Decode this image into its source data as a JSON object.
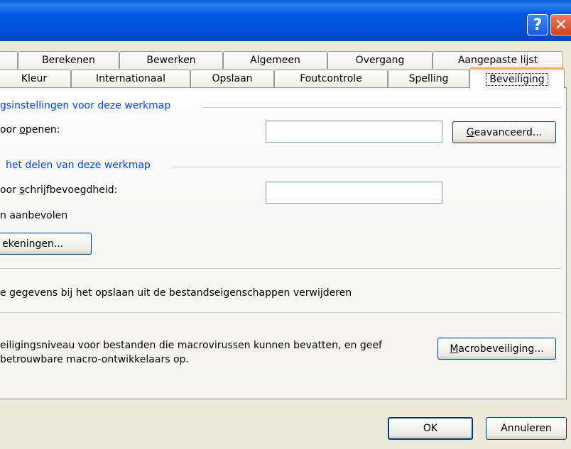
{
  "window": {
    "help_glyph": "?",
    "close_glyph": "✕"
  },
  "tabs": {
    "row1": [
      "Berekenen",
      "Bewerken",
      "Algemeen",
      "Overgang",
      "Aangepaste lijst"
    ],
    "row2": [
      "Kleur",
      "Internationaal",
      "Opslaan",
      "Foutcontrole",
      "Spelling",
      "Beveiliging"
    ],
    "active": "Beveiliging"
  },
  "encryption": {
    "section_title": "gsinstellingen voor deze werkmap",
    "open_label_pre": "oor ",
    "open_label_ul": "o",
    "open_label_post": "penen:",
    "open_value": "",
    "advanced_button_ul": "G",
    "advanced_button_rest": "eavanceerd..."
  },
  "sharing": {
    "section_title": "het delen van deze werkmap",
    "write_label_pre": "oor ",
    "write_label_ul": "s",
    "write_label_post": "chrijfbevoegdheid:",
    "write_value": "",
    "recommended_label": "n aanbevolen",
    "signatures_button": "ekeningen..."
  },
  "privacy": {
    "remove_info_label": "e gegevens bij het opslaan uit de bestandseigenschappen verwijderen"
  },
  "macro": {
    "text_line1": "eiligingsniveau voor bestanden die macrovirussen kunnen bevatten, en geef",
    "text_line2": "betrouwbare macro-ontwikkelaars op.",
    "button_ul": "M",
    "button_rest": "acrobeveiliging..."
  },
  "footer": {
    "ok": "OK",
    "cancel": "Annuleren"
  }
}
